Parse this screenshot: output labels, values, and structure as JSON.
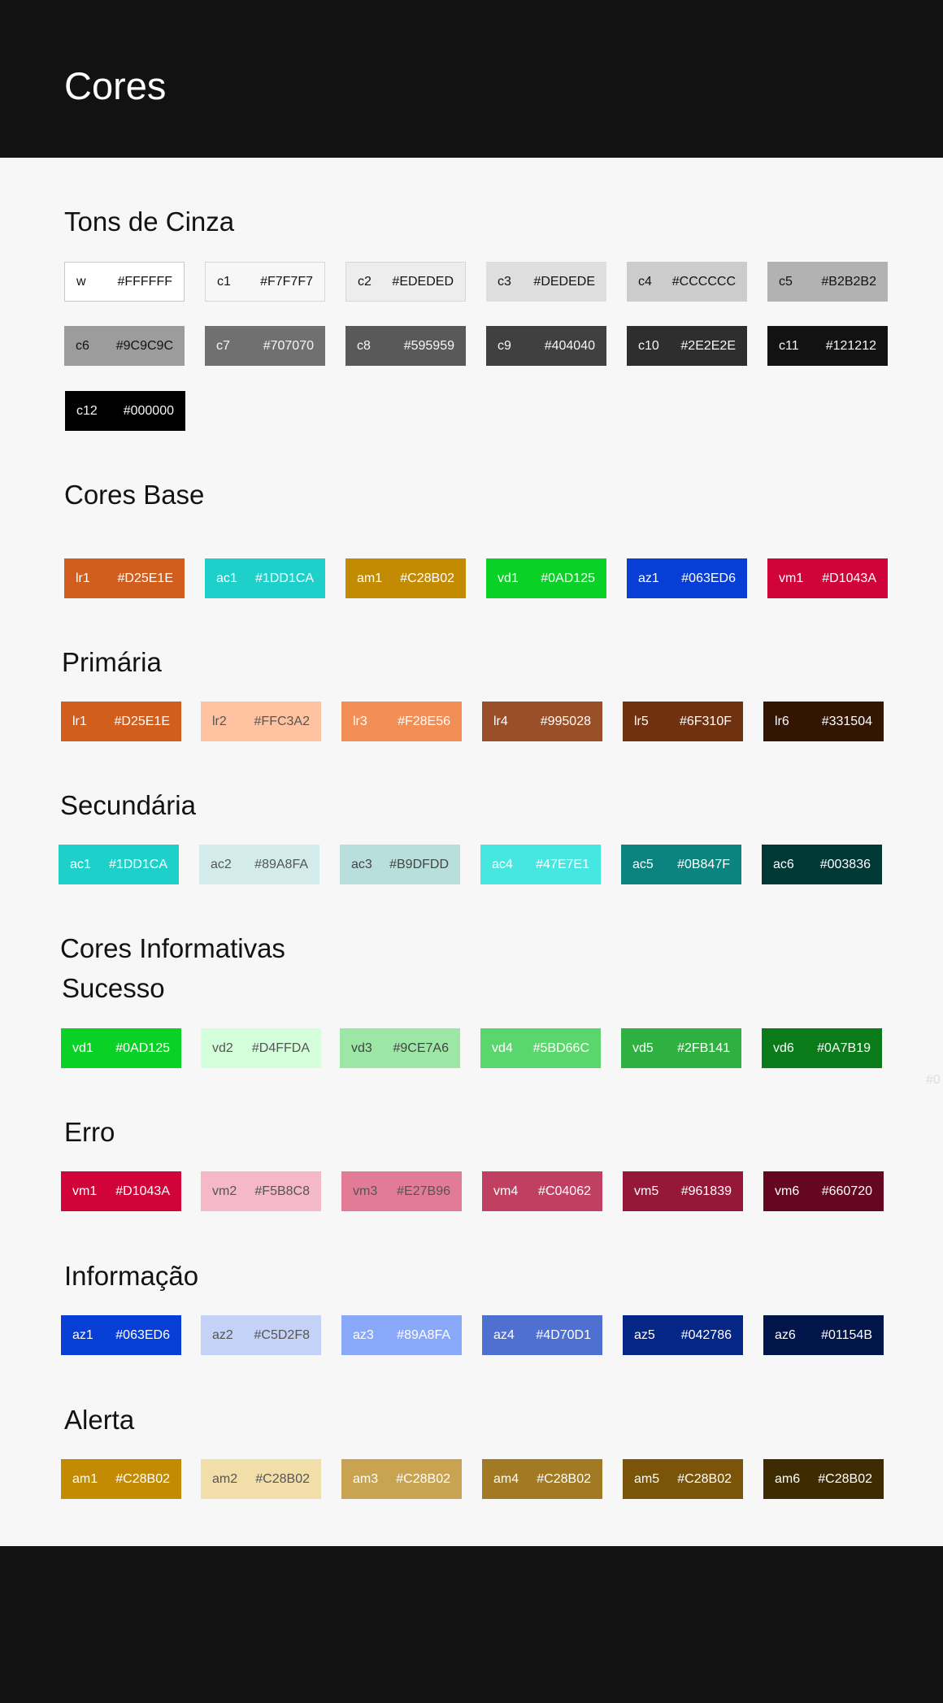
{
  "page_title": "Cores",
  "stray_text": "#0",
  "sections": [
    {
      "title": "Tons de Cinza",
      "swatches": [
        {
          "code": "w",
          "hex": "#FFFFFF",
          "bg": "#FFFFFF",
          "fg": "#121212"
        },
        {
          "code": "c1",
          "hex": "#F7F7F7",
          "bg": "#F7F7F7",
          "fg": "#121212"
        },
        {
          "code": "c2",
          "hex": "#EDEDED",
          "bg": "#EDEDED",
          "fg": "#121212"
        },
        {
          "code": "c3",
          "hex": "#DEDEDE",
          "bg": "#DEDEDE",
          "fg": "#121212"
        },
        {
          "code": "c4",
          "hex": "#CCCCCC",
          "bg": "#CCCCCC",
          "fg": "#121212"
        },
        {
          "code": "c5",
          "hex": "#B2B2B2",
          "bg": "#B2B2B2",
          "fg": "#121212"
        },
        {
          "code": "c6",
          "hex": "#9C9C9C",
          "bg": "#9C9C9C",
          "fg": "#121212"
        },
        {
          "code": "c7",
          "hex": "#707070",
          "bg": "#707070",
          "fg": "#F7F7F7"
        },
        {
          "code": "c8",
          "hex": "#595959",
          "bg": "#595959",
          "fg": "#F7F7F7"
        },
        {
          "code": "c9",
          "hex": "#404040",
          "bg": "#404040",
          "fg": "#F7F7F7"
        },
        {
          "code": "c10",
          "hex": "#2E2E2E",
          "bg": "#2E2E2E",
          "fg": "#F7F7F7"
        },
        {
          "code": "c11",
          "hex": "#121212",
          "bg": "#121212",
          "fg": "#F7F7F7"
        },
        {
          "code": "c12",
          "hex": "#000000",
          "bg": "#000000",
          "fg": "#F7F7F7"
        }
      ]
    },
    {
      "title": "Cores Base",
      "swatches": [
        {
          "code": "lr1",
          "hex": "#D25E1E",
          "bg": "#D25E1E",
          "fg": "#FFFFFF"
        },
        {
          "code": "ac1",
          "hex": "#1DD1CA",
          "bg": "#1DD1CA",
          "fg": "#FFFFFF"
        },
        {
          "code": "am1",
          "hex": "#C28B02",
          "bg": "#C28B02",
          "fg": "#FFFFFF"
        },
        {
          "code": "vd1",
          "hex": "#0AD125",
          "bg": "#0AD125",
          "fg": "#FFFFFF"
        },
        {
          "code": "az1",
          "hex": "#063ED6",
          "bg": "#063ED6",
          "fg": "#FFFFFF"
        },
        {
          "code": "vm1",
          "hex": "#D1043A",
          "bg": "#D1043A",
          "fg": "#FFFFFF"
        }
      ]
    },
    {
      "title": "Primária",
      "swatches": [
        {
          "code": "lr1",
          "hex": "#D25E1E",
          "bg": "#D25E1E",
          "fg": "#FFFFFF"
        },
        {
          "code": "lr2",
          "hex": "#FFC3A2",
          "bg": "#FFC3A2",
          "fg": "#555555"
        },
        {
          "code": "lr3",
          "hex": "#F28E56",
          "bg": "#F28E56",
          "fg": "#FFFFFF"
        },
        {
          "code": "lr4",
          "hex": "#995028",
          "bg": "#995028",
          "fg": "#FFFFFF"
        },
        {
          "code": "lr5",
          "hex": "#6F310F",
          "bg": "#6F310F",
          "fg": "#FFFFFF"
        },
        {
          "code": "lr6",
          "hex": "#331504",
          "bg": "#331504",
          "fg": "#FFFFFF"
        }
      ]
    },
    {
      "title": "Secundária",
      "swatches": [
        {
          "code": "ac1",
          "hex": "#1DD1CA",
          "bg": "#1DD1CA",
          "fg": "#FFFFFF"
        },
        {
          "code": "ac2",
          "hex": "#89A8FA",
          "bg": "#D3ECEB",
          "fg": "#555555"
        },
        {
          "code": "ac3",
          "hex": "#B9DFDD",
          "bg": "#B9DFDD",
          "fg": "#444444"
        },
        {
          "code": "ac4",
          "hex": "#47E7E1",
          "bg": "#47E7E1",
          "fg": "#FFFFFF"
        },
        {
          "code": "ac5",
          "hex": "#0B847F",
          "bg": "#0B847F",
          "fg": "#FFFFFF"
        },
        {
          "code": "ac6",
          "hex": "#003836",
          "bg": "#003836",
          "fg": "#FFFFFF"
        }
      ]
    },
    {
      "title": "Cores Informativas",
      "swatches": []
    },
    {
      "title": "Sucesso",
      "swatches": [
        {
          "code": "vd1",
          "hex": "#0AD125",
          "bg": "#0AD125",
          "fg": "#FFFFFF"
        },
        {
          "code": "vd2",
          "hex": "#D4FFDA",
          "bg": "#D4FFDA",
          "fg": "#555555"
        },
        {
          "code": "vd3",
          "hex": "#9CE7A6",
          "bg": "#9CE7A6",
          "fg": "#444444"
        },
        {
          "code": "vd4",
          "hex": "#5BD66C",
          "bg": "#5BD66C",
          "fg": "#FFFFFF"
        },
        {
          "code": "vd5",
          "hex": "#2FB141",
          "bg": "#2FB141",
          "fg": "#FFFFFF"
        },
        {
          "code": "vd6",
          "hex": "#0A7B19",
          "bg": "#0A7B19",
          "fg": "#FFFFFF"
        }
      ]
    },
    {
      "title": "Erro",
      "swatches": [
        {
          "code": "vm1",
          "hex": "#D1043A",
          "bg": "#D1043A",
          "fg": "#FFFFFF"
        },
        {
          "code": "vm2",
          "hex": "#F5B8C8",
          "bg": "#F5B8C8",
          "fg": "#555555"
        },
        {
          "code": "vm3",
          "hex": "#E27B96",
          "bg": "#E27B96",
          "fg": "#555555"
        },
        {
          "code": "vm4",
          "hex": "#C04062",
          "bg": "#C04062",
          "fg": "#FFFFFF"
        },
        {
          "code": "vm5",
          "hex": "#961839",
          "bg": "#961839",
          "fg": "#FFFFFF"
        },
        {
          "code": "vm6",
          "hex": "#660720",
          "bg": "#660720",
          "fg": "#FFFFFF"
        }
      ]
    },
    {
      "title": "Informação",
      "swatches": [
        {
          "code": "az1",
          "hex": "#063ED6",
          "bg": "#063ED6",
          "fg": "#FFFFFF"
        },
        {
          "code": "az2",
          "hex": "#C5D2F8",
          "bg": "#C5D2F8",
          "fg": "#555555"
        },
        {
          "code": "az3",
          "hex": "#89A8FA",
          "bg": "#89A8FA",
          "fg": "#FFFFFF"
        },
        {
          "code": "az4",
          "hex": "#4D70D1",
          "bg": "#4D70D1",
          "fg": "#FFFFFF"
        },
        {
          "code": "az5",
          "hex": "#042786",
          "bg": "#042786",
          "fg": "#FFFFFF"
        },
        {
          "code": "az6",
          "hex": "#01154B",
          "bg": "#01154B",
          "fg": "#FFFFFF"
        }
      ]
    },
    {
      "title": "Alerta",
      "swatches": [
        {
          "code": "am1",
          "hex": "#C28B02",
          "bg": "#C28B02",
          "fg": "#FFFFFF"
        },
        {
          "code": "am2",
          "hex": "#C28B02",
          "bg": "#F2DEA9",
          "fg": "#555555"
        },
        {
          "code": "am3",
          "hex": "#C28B02",
          "bg": "#C7A352",
          "fg": "#FFFFFF"
        },
        {
          "code": "am4",
          "hex": "#C28B02",
          "bg": "#A17A23",
          "fg": "#FFFFFF"
        },
        {
          "code": "am5",
          "hex": "#C28B02",
          "bg": "#7A5408",
          "fg": "#FFFFFF"
        },
        {
          "code": "am6",
          "hex": "#C28B02",
          "bg": "#3E2B02",
          "fg": "#FFFFFF"
        }
      ]
    }
  ]
}
